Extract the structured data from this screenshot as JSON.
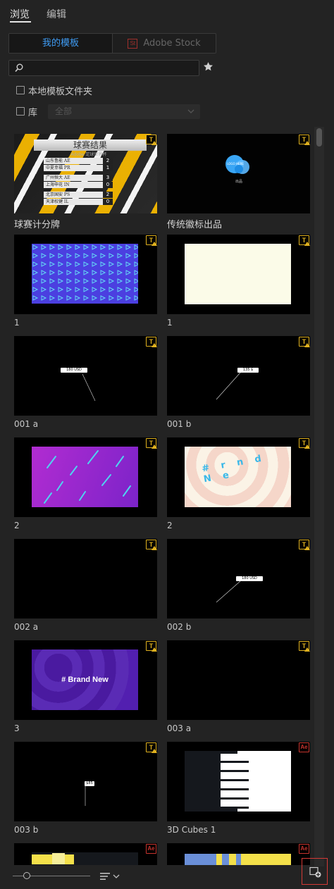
{
  "tabs": [
    {
      "label": "浏览",
      "active": true
    },
    {
      "label": "编辑",
      "active": false
    }
  ],
  "source": {
    "my_templates": "我的模板",
    "stock_badge": "St",
    "adobe_stock": "Adobe Stock"
  },
  "search": {
    "value": "",
    "placeholder": ""
  },
  "filters": {
    "local_folder": {
      "label": "本地模板文件夹",
      "checked": false
    },
    "library": {
      "label": "库",
      "checked": false,
      "select_value": "全部"
    }
  },
  "templates": [
    {
      "label": "球赛计分牌",
      "badge": "T",
      "thumb": "scoreboard",
      "thumb_text": {
        "title": "球赛结果",
        "subtitle": "Adobe 足球世界杯",
        "rows": [
          "山东鲁能 AE",
          "中夏幸福 PR",
          "广州恒大 AE",
          "上海申花 IN",
          "北京国安 PS",
          "天津权健 IL"
        ],
        "scores": [
          "2",
          "1",
          "3",
          "0",
          "2",
          "0"
        ]
      }
    },
    {
      "label": "传统徽标出品",
      "badge": "T",
      "thumb": "logo",
      "thumb_text": {
        "logo": "LOGO HERE",
        "caption": "出品"
      }
    },
    {
      "label": "1",
      "badge": "T",
      "thumb": "triangles"
    },
    {
      "label": "1",
      "badge": "T",
      "thumb": "cream"
    },
    {
      "label": "001 a",
      "badge": "T",
      "thumb": "callout-a",
      "thumb_text": {
        "price": "180 USD"
      }
    },
    {
      "label": "001 b",
      "badge": "T",
      "thumb": "callout-b",
      "thumb_text": {
        "price": "135 $"
      }
    },
    {
      "label": "2",
      "badge": "T",
      "thumb": "purple-dashes"
    },
    {
      "label": "2",
      "badge": "T",
      "thumb": "ripple",
      "thumb_text": {
        "word": "# r n d N e"
      }
    },
    {
      "label": "002 a",
      "badge": "T",
      "thumb": "black"
    },
    {
      "label": "002 b",
      "badge": "T",
      "thumb": "callout-c",
      "thumb_text": {
        "price": "180 USD"
      }
    },
    {
      "label": "3",
      "badge": "T",
      "thumb": "brand",
      "thumb_text": {
        "headline": "# Brand New"
      }
    },
    {
      "label": "003 a",
      "badge": "T",
      "thumb": "black"
    },
    {
      "label": "003 b",
      "badge": "T",
      "thumb": "callout-d",
      "thumb_text": {
        "price": "$85"
      }
    },
    {
      "label": "3D Cubes 1",
      "badge": "Ae",
      "thumb": "cubes"
    },
    {
      "label": "",
      "badge": "Ae",
      "thumb": "partial-a"
    },
    {
      "label": "",
      "badge": "Ae",
      "thumb": "partial-b"
    }
  ],
  "footer": {
    "new_item": "new-item"
  },
  "colors": {
    "accent": "#3f9cf4",
    "badge_text": "#e1b21f",
    "badge_ae": "#c6342e",
    "highlight": "#d53a36"
  }
}
